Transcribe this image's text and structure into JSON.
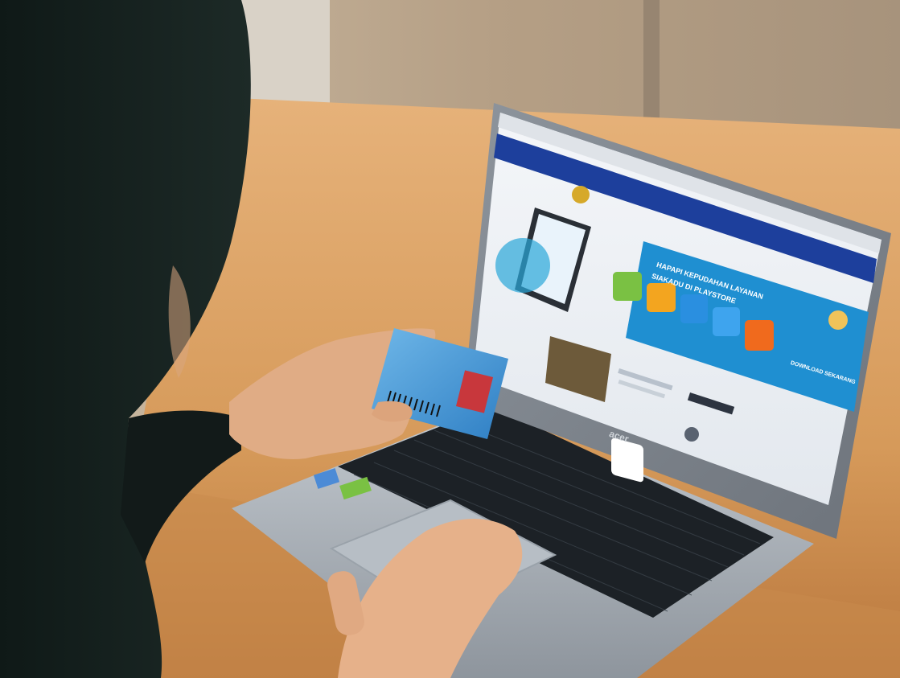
{
  "scene": {
    "colors": {
      "wall": "#b9a58e",
      "desk": "#d59a5c",
      "hijab": "#14201d",
      "skin": "#e7b791",
      "laptop_silver": "#a9b0b7",
      "keyboard": "#1b1f24",
      "screen_blue": "#1d3f9c",
      "card_blue": "#3b8fd1"
    }
  },
  "screen": {
    "banner_line1": "HAPAPI KEPUDAHAN LAYANAN",
    "banner_line2": "SIAKADU DI PLAYSTORE",
    "download_label": "DOWNLOAD SEKARANG"
  },
  "laptop": {
    "brand": "acer"
  }
}
